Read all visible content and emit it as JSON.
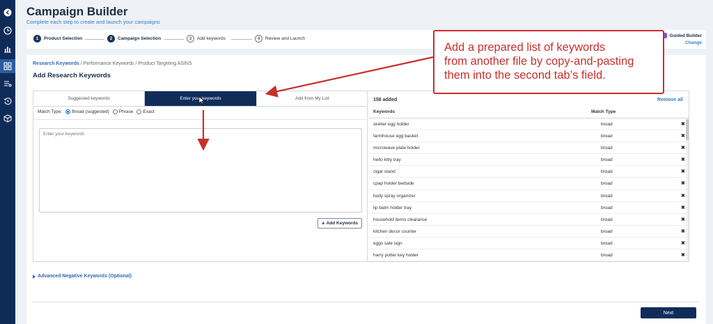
{
  "header": {
    "title": "Campaign Builder",
    "subtitle": "Complete each step to create and launch your campaigns"
  },
  "steps": [
    {
      "num": "1",
      "label": "Product Selection",
      "state": "done"
    },
    {
      "num": "2",
      "label": "Campaign Selection",
      "state": "done"
    },
    {
      "num": "3",
      "label": "Add keywords",
      "state": "pending"
    },
    {
      "num": "4",
      "label": "Review and Launch",
      "state": "pending"
    }
  ],
  "guided": {
    "label": "Guided Builder",
    "change": "Change"
  },
  "breadcrumb": {
    "current": "Research Keywords",
    "rest": " / Performance Keywords / Product Targeting ASINS"
  },
  "section_title": "Add Research Keywords",
  "tabs": [
    {
      "label": "Suggested keywords",
      "active": false
    },
    {
      "label": "Enter your keywords",
      "active": true
    },
    {
      "label": "Add from My List",
      "active": false
    }
  ],
  "match_type": {
    "label": "Match Type:",
    "options": [
      "Broad (suggested)",
      "Phrase",
      "Exact"
    ],
    "selected": "Broad (suggested)"
  },
  "keywords_input": {
    "placeholder": "Enter your keywords"
  },
  "add_keywords_label": "Add Keywords",
  "added": {
    "count_label": "158 added",
    "remove_all": "Remove all",
    "col_keywords": "Keywords",
    "col_match": "Match Type",
    "rows": [
      {
        "keyword": "skelter egg holder",
        "match": "broad"
      },
      {
        "keyword": "farmhouse egg basket",
        "match": "broad"
      },
      {
        "keyword": "microwave plate holder",
        "match": "broad"
      },
      {
        "keyword": "hello kitty tray",
        "match": "broad"
      },
      {
        "keyword": "cigar stand",
        "match": "broad"
      },
      {
        "keyword": "cpap holder bedside",
        "match": "broad"
      },
      {
        "keyword": "body spray organizer",
        "match": "broad"
      },
      {
        "keyword": "lip balm holder tray",
        "match": "broad"
      },
      {
        "keyword": "household items clearance",
        "match": "broad"
      },
      {
        "keyword": "kitchen decor counter",
        "match": "broad"
      },
      {
        "keyword": "eggs sale sign",
        "match": "broad"
      },
      {
        "keyword": "harry potter key holder",
        "match": "broad"
      }
    ]
  },
  "advanced_negative": "Advanced Negative Keywords (Optional)",
  "next_label": "Next",
  "callout": {
    "line1": "Add a prepared list of keywords",
    "line2": "from another file by copy-and-pasting",
    "line3": "them into the second tab’s field."
  },
  "colors": {
    "navy": "#102d5a",
    "accent_blue": "#2f7fcf",
    "annotation_red": "#c8302b"
  }
}
